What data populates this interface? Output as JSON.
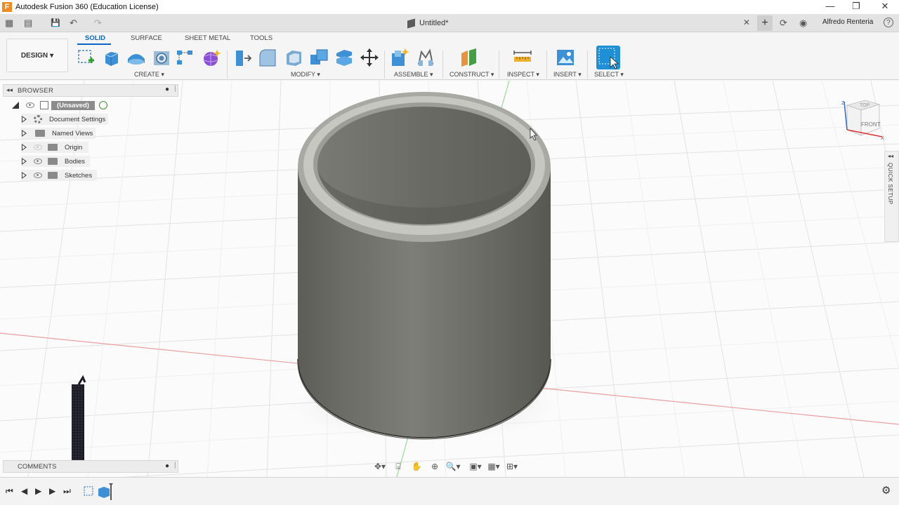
{
  "app": {
    "window_title": "Autodesk Fusion 360 (Education License)",
    "logo_letter": "F",
    "controls": {
      "minimize": "—",
      "restore": "❐",
      "close": "✕"
    }
  },
  "quickbar": {
    "document_tab": "Untitled*",
    "close_tab": "✕",
    "new_tab": "+",
    "user_name": "Alfredo Renteria",
    "help": "?"
  },
  "toolbar": {
    "workspace_button": "DESIGN",
    "tabs": [
      "SOLID",
      "SURFACE",
      "SHEET METAL",
      "TOOLS"
    ],
    "active_tab": "SOLID",
    "groups": {
      "create": "CREATE",
      "modify": "MODIFY",
      "assemble": "ASSEMBLE",
      "construct": "CONSTRUCT",
      "inspect": "INSPECT",
      "insert": "INSERT",
      "select": "SELECT"
    },
    "dropdown_arrow": "▾"
  },
  "browser": {
    "title": "BROWSER",
    "root": "(Unsaved)",
    "items": [
      "Document Settings",
      "Named Views",
      "Origin",
      "Bodies",
      "Sketches"
    ]
  },
  "comments": {
    "title": "COMMENTS"
  },
  "viewcube": {
    "top": "TOP",
    "front": "FRONT",
    "axis_x": "X",
    "axis_z": "Z"
  },
  "quick_setup": {
    "label": "QUICK SETUP"
  },
  "colors": {
    "accent": "#0a66c2",
    "body_gray": "#6b6b66",
    "axis_red": "#e08a8a",
    "axis_green": "#8fd08f",
    "select_blue": "#1f8fd6"
  },
  "icons": {
    "grid_icon": "▦",
    "file_icon": "▤",
    "save_icon": "💾",
    "undo_icon": "↶",
    "redo_icon": "↷",
    "job_status_icon": "⟳",
    "notification_icon": "◉",
    "gear_icon": "⚙"
  },
  "timeline": {
    "first": "⏮",
    "prev": "◀",
    "play": "▶",
    "next": "▶",
    "last": "⏭"
  }
}
